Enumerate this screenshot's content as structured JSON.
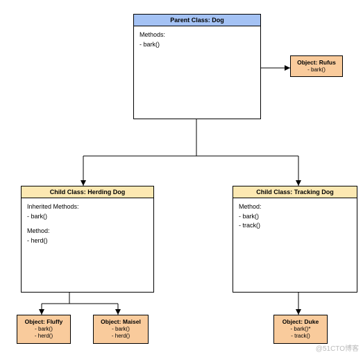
{
  "parent": {
    "title": "Parent Class: Dog",
    "section1": "Methods:",
    "m1": "- bark()"
  },
  "rufus": {
    "title": "Object: Rufus",
    "m1": "- bark()"
  },
  "herding": {
    "title": "Child Class: Herding Dog",
    "section1": "Inherited Methods:",
    "m1": "- bark()",
    "section2": "Method:",
    "m2": "- herd()"
  },
  "tracking": {
    "title": "Child Class: Tracking Dog",
    "section1": "Method:",
    "m1": "- bark()",
    "m2": "- track()"
  },
  "fluffy": {
    "title": "Object: Fluffy",
    "m1": "- bark()",
    "m2": "- herd()"
  },
  "maisel": {
    "title": "Object: Maisel",
    "m1": "- bark()",
    "m2": "- herd()"
  },
  "duke": {
    "title": "Object: Duke",
    "m1": "- bark()*",
    "m2": "- track()"
  },
  "watermark": "@51CTO博客"
}
